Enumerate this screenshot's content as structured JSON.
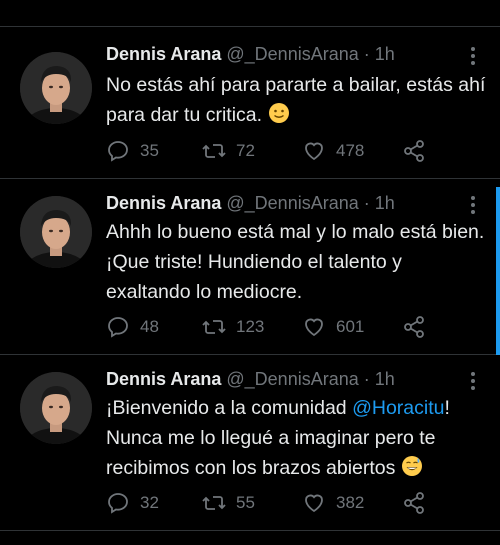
{
  "tweets": [
    {
      "name": "Dennis Arana",
      "handle": "@_DennisArana",
      "sep": "·",
      "time": "1h",
      "text": "No estás ahí para pararte a bailar, estás ahí para dar tu critica.",
      "emoji": "slightly-smiling-face",
      "replies": "35",
      "retweets": "72",
      "likes": "478"
    },
    {
      "name": "Dennis Arana",
      "handle": "@_DennisArana",
      "sep": "·",
      "time": "1h",
      "text": "Ahhh lo bueno está mal y lo malo está bien. ¡Que triste! Hundiendo el talento y exaltando lo mediocre.",
      "replies": "48",
      "retweets": "123",
      "likes": "601"
    },
    {
      "name": "Dennis Arana",
      "handle": "@_DennisArana",
      "sep": "·",
      "time": "1h",
      "text_before": "¡Bienvenido a la comunidad ",
      "mention": "@Horacitu",
      "text_after": "! Nunca me lo llegué a imaginar pero te recibimos con los brazos abiertos",
      "emoji": "grinning-face-with-sweat",
      "replies": "32",
      "retweets": "55",
      "likes": "382"
    }
  ],
  "colors": {
    "background": "#000000",
    "text": "#e7e9ea",
    "muted": "#71767b",
    "link": "#1d9bf0",
    "divider": "#2f3336"
  }
}
